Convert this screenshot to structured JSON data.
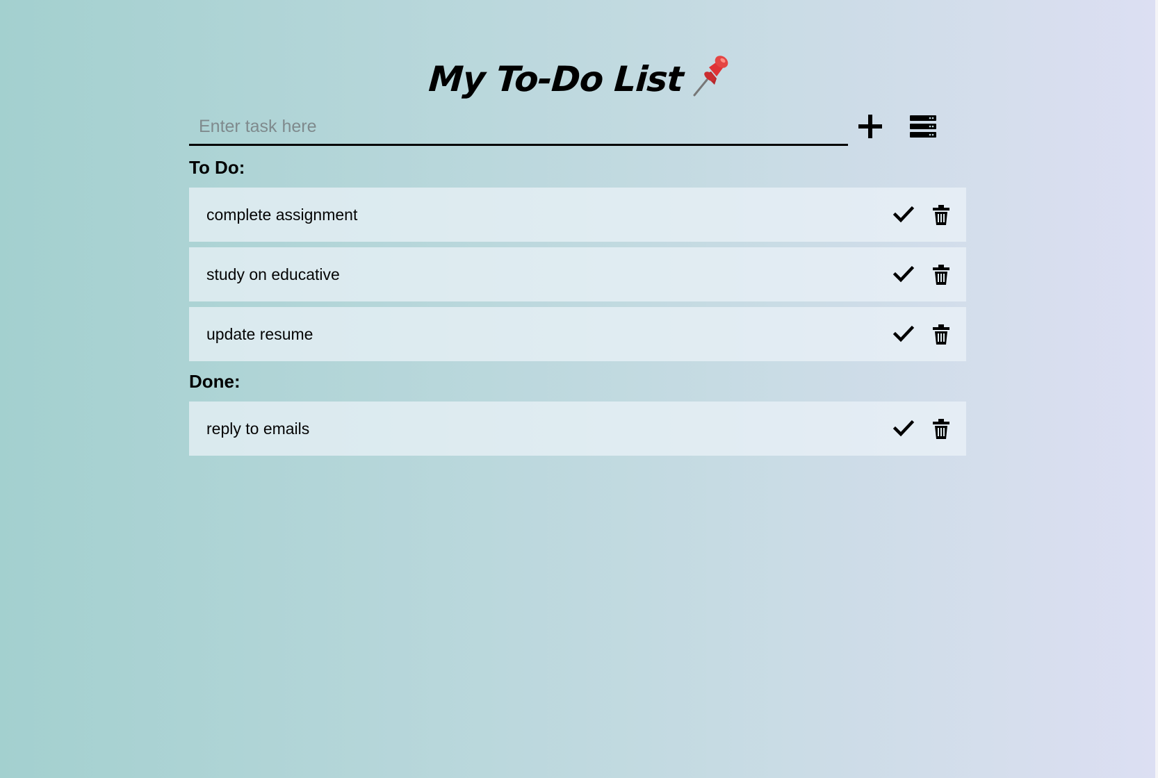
{
  "header": {
    "title": "My To-Do List",
    "pin_icon": "pushpin-icon"
  },
  "input": {
    "placeholder": "Enter task here",
    "value": ""
  },
  "toolbar": {
    "add_icon": "plus-icon",
    "menu_icon": "list-menu-icon"
  },
  "sections": {
    "todo_label": "To Do:",
    "done_label": "Done:"
  },
  "tasks": {
    "todo": [
      {
        "text": "complete assignment"
      },
      {
        "text": "study on educative"
      },
      {
        "text": "update resume"
      }
    ],
    "done": [
      {
        "text": "reply to emails"
      }
    ]
  },
  "colors": {
    "background_left": "#a3d0cf",
    "background_right": "#dcdff3",
    "item_background": "#e3edf1",
    "text": "#000000",
    "pin": "#d82f2f"
  }
}
